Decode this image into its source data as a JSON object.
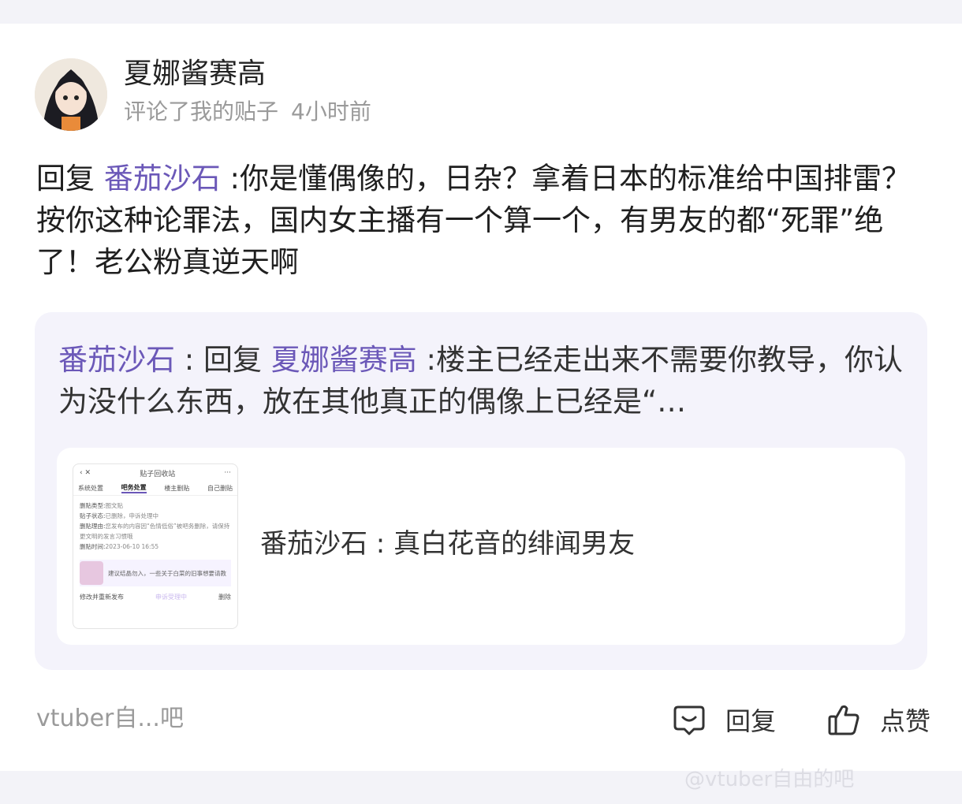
{
  "comment": {
    "author": "夏娜酱赛高",
    "action": "评论了我的贴子",
    "time": "4小时前",
    "reply_prefix": "回复 ",
    "reply_mention": "番茄沙石",
    "reply_body": " :你是懂偶像的，日杂？拿着日本的标准给中国排雷？按你这种论罪法，国内女主播有一个算一个，有男友的都“死罪”绝了！老公粉真逆天啊"
  },
  "quote": {
    "author": "番茄沙石",
    "sep": " : 回复 ",
    "mention": "夏娜酱赛高",
    "body": " :楼主已经走出来不需要你教导，你认为没什么东西，放在其他真正的偶像上已经是“…"
  },
  "post": {
    "title": "番茄沙石 : 真白花音的绯闻男友",
    "thumbnail": {
      "header": "贴子回收站",
      "tabs": [
        "系统处置",
        "吧务处置",
        "楼主删贴",
        "自己删贴"
      ],
      "rows": [
        {
          "k": "删贴类型:",
          "v": "图文贴"
        },
        {
          "k": "贴子状态:",
          "v": "已删除，申诉处理中"
        },
        {
          "k": "删贴理由:",
          "v": "您发布的内容因“色情低俗”被吧务删除，请保持更文明的发言习惯哦"
        },
        {
          "k": "删贴时间:",
          "v": "2023-06-10 16:55"
        }
      ],
      "banner": "建议结晶勿入，一些关于白菜的旧事想要请教",
      "footer_left": "修改并重新发布",
      "footer_mid": "申诉受理中",
      "footer_right": "删除"
    }
  },
  "footer": {
    "source": "vtuber自...吧",
    "reply_label": "回复",
    "like_label": "点赞"
  },
  "watermark": "@vtuber自由的吧",
  "colors": {
    "mention": "#6b58b8",
    "quote_bg": "#f4f3fb",
    "strip": "#f3f3f8"
  }
}
